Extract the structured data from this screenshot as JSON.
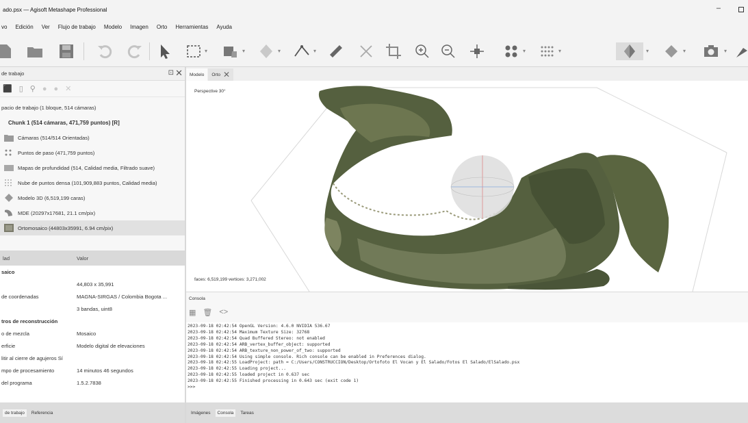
{
  "window": {
    "title": "ado.psx — Agisoft Metashape Professional",
    "minimize": "–",
    "maximize": ""
  },
  "menu": [
    "vo",
    "Edición",
    "Ver",
    "Flujo de trabajo",
    "Modelo",
    "Imagen",
    "Orto",
    "Herramientas",
    "Ayuda"
  ],
  "workspace": {
    "panel_title": "de trabajo",
    "float_glyph": "⊡",
    "close_glyph": "✕",
    "tools": [
      "⬛",
      "▯",
      "⚲",
      "●",
      "●",
      "✕"
    ],
    "tree": [
      {
        "text": "pacio de trabajo (1 bloque, 514 cámaras)",
        "level": 0,
        "icon": "none"
      },
      {
        "text": "Chunk 1 (514 cámaras, 471,759 puntos) [R]",
        "level": 1,
        "icon": "none"
      },
      {
        "text": "Cámaras (514/514 Orientadas)",
        "level": 2,
        "icon": "folder-icon"
      },
      {
        "text": "Puntos de paso (471,759 puntos)",
        "level": 2,
        "icon": "tie-points-icon"
      },
      {
        "text": "Mapas de profundidad (514, Calidad media, Filtrado suave)",
        "level": 2,
        "icon": "depth-maps-icon"
      },
      {
        "text": "Nube de puntos densa (101,909,883 puntos, Calidad media)",
        "level": 2,
        "icon": "dense-cloud-icon"
      },
      {
        "text": "Modelo 3D (6,519,199 caras)",
        "level": 2,
        "icon": "model-icon"
      },
      {
        "text": "MDE (20297x17681, 21.1 cm/pix)",
        "level": 2,
        "icon": "dem-icon"
      },
      {
        "text": "Ortomosaico (44803x35991, 6.94 cm/pix)",
        "level": 2,
        "icon": "ortho-icon",
        "selected": true
      }
    ]
  },
  "properties": {
    "col_property": "lad",
    "col_value": "Valor",
    "rows": [
      {
        "k": "saico",
        "v": "",
        "group": true
      },
      {
        "k": "",
        "v": "44,803 x 35,991"
      },
      {
        "k": "de coordenadas",
        "v": "MAGNA-SIRGAS / Colombia Bogota ..."
      },
      {
        "k": "",
        "v": "3 bandas, uint8"
      },
      {
        "k": "tros de reconstrucción",
        "v": "",
        "group": true
      },
      {
        "k": "o de mezcla",
        "v": "Mosaico"
      },
      {
        "k": "erficie",
        "v": "Modelo digital de elevaciones"
      },
      {
        "k": "litir al cierre de agujeros Sí",
        "v": ""
      },
      {
        "k": "mpo de procesamiento",
        "v": "14 minutos 46 segundos"
      },
      {
        "k": "del programa",
        "v": "1.5.2.7838"
      }
    ]
  },
  "left_tabs": [
    "de trabajo",
    "Referencia"
  ],
  "view_tabs": [
    {
      "label": "Modelo",
      "active": true
    },
    {
      "label": "Orto",
      "active": false
    }
  ],
  "viewport": {
    "perspective": "Perspective 30°",
    "stats": "faces: 6,519,199 vertices: 3,271,002"
  },
  "console": {
    "title": "Consola",
    "lines": [
      "2023-09-18 02:42:54 OpenGL Version: 4.6.0 NVIDIA 536.67",
      "2023-09-18 02:42:54 Maximum Texture Size: 32768",
      "2023-09-18 02:42:54 Quad Buffered Stereo: not enabled",
      "2023-09-18 02:42:54 ARB_vertex_buffer_object: supported",
      "2023-09-18 02:42:54 ARB_texture_non_power_of_two: supported",
      "2023-09-18 02:42:54 Using simple console. Rich console can be enabled in Preferences dialog.",
      "2023-09-18 02:42:55 LoadProject: path = C:/Users/CONSTRUCCION/Desktop/Ortofoto El Vocan y El Salado/Fotos El Salado/ElSalado.psx",
      "2023-09-18 02:42:55 Loading project...",
      "2023-09-18 02:42:55 loaded project in 0.637 sec",
      "2023-09-18 02:42:55 Finished processing in 0.643 sec (exit code 1)",
      ">>>"
    ]
  },
  "bottom_tabs": [
    "Imágenes",
    "Consola",
    "Tareas"
  ],
  "colors": {
    "sphere": "#d6d6d6",
    "terrain_dark": "#4a5538",
    "terrain_light": "#8a8a6a",
    "grid": "#dcdcdc"
  }
}
